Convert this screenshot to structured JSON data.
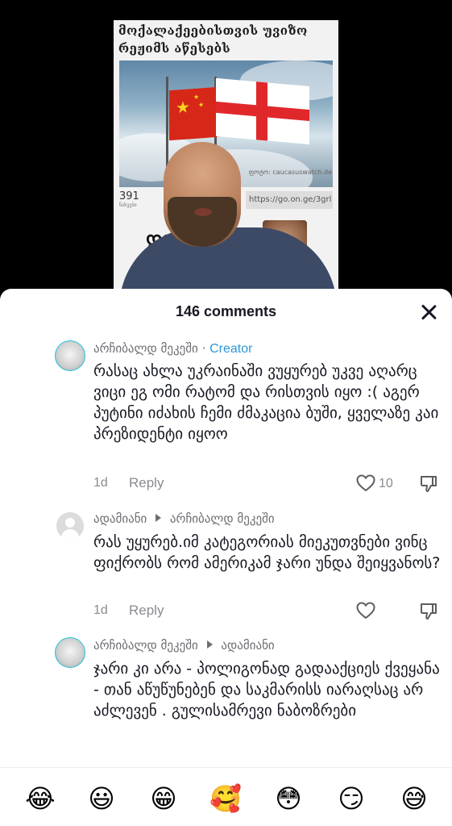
{
  "video": {
    "headline": "მოქალაქეებისთვის უვიზო რეჟიმს აწესებს",
    "photo_credit": "ფოტო: caucasuswatch.de",
    "views": "391",
    "views_label": "ნახვები",
    "link": "https://go.on.ge/3grl",
    "logo": "ᲓᲔ"
  },
  "comments_header": {
    "count_label": "146 comments"
  },
  "comments": [
    {
      "author": "არჩიბალდ მეკეში",
      "badge": "Creator",
      "text": "რასაც ახლა უკრაინაში ვუყურებ უკვე აღარც ვიცი ეგ ომი რატომ და რისთვის იყო :( აგერ პუტინი იძახის ჩემი ძმაკაცია ბუში, ყველაზე კაი პრეზიდენტი იყოო",
      "time": "1d",
      "reply": "Reply",
      "likes": "10"
    },
    {
      "author": "ადამიანი",
      "reply_to": "არჩიბალდ მეკეში",
      "text": "რას უყურებ.იმ კატეგორიას მიეკუთვნები ვინც ფიქრობს რომ ამერიკამ ჯარი უნდა შეიყვანოს?",
      "time": "1d",
      "reply": "Reply"
    },
    {
      "author": "არჩიბალდ მეკეში",
      "reply_to": "ადამიანი",
      "text": "ჯარი კი არა - პოლიგონად გადააქციეს ქვეყანა - თან აწუწუნებენ და საკმარისს იარაღსაც არ აძლევენ . გულისამრევი ნაბოზრები"
    }
  ],
  "emoji_bar": [
    "😂",
    "😃",
    "😁",
    "🥰",
    "😳",
    "😏",
    "😅"
  ]
}
